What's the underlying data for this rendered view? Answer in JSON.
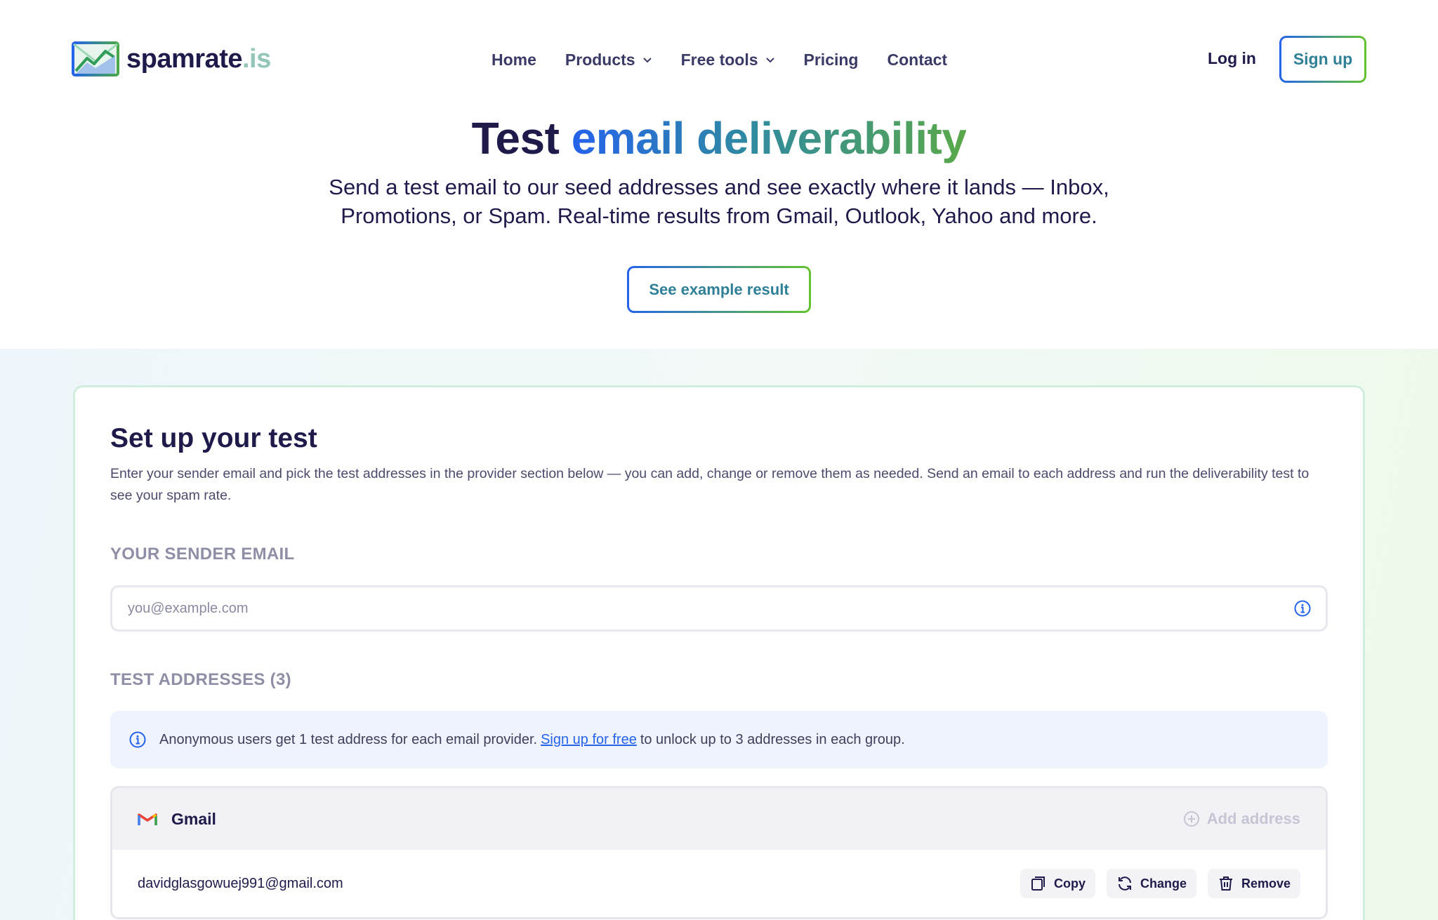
{
  "brand": {
    "name": "spamrate",
    "tld": ".is",
    "logo_icon": "chart-envelope-logo"
  },
  "nav": {
    "items": [
      {
        "label": "Home",
        "has_dropdown": false
      },
      {
        "label": "Products",
        "has_dropdown": true
      },
      {
        "label": "Free tools",
        "has_dropdown": true
      },
      {
        "label": "Pricing",
        "has_dropdown": false
      },
      {
        "label": "Contact",
        "has_dropdown": false
      }
    ],
    "login_label": "Log in",
    "signup_label": "Sign up"
  },
  "hero": {
    "title_prefix": "Test",
    "title_highlight": "email deliverability",
    "subtitle": "Send a test email to our seed addresses and see exactly where it lands — Inbox, Promotions, or Spam. Real-time results from Gmail, Outlook, Yahoo and more.",
    "cta_label": "See example result"
  },
  "setup": {
    "title": "Set up your test",
    "description": "Enter your sender email and pick the test addresses in the provider section below — you can add, change or remove them as needed. Send an email to each address and run the deliverability test to see your spam rate.",
    "sender_label": "YOUR SENDER EMAIL",
    "sender_placeholder": "you@example.com",
    "sender_value": "",
    "test_addresses_label": "TEST ADDRESSES (3)",
    "notice": {
      "before": "Anonymous users get 1 test address for each email provider.",
      "link": "Sign up for free",
      "after": "to unlock up to 3 addresses in each group."
    },
    "providers": [
      {
        "name": "Gmail",
        "icon": "gmail-icon",
        "add_label": "Add address",
        "addresses": [
          {
            "email": "davidglasgowuej991@gmail.com"
          }
        ]
      }
    ],
    "row_actions": {
      "copy": "Copy",
      "change": "Change",
      "remove": "Remove"
    }
  },
  "colors": {
    "navy": "#1e1b4b",
    "gradient_start": "#2563eb",
    "gradient_end": "#65c32f",
    "link": "#2563eb",
    "muted_label": "#8e8ea6"
  }
}
